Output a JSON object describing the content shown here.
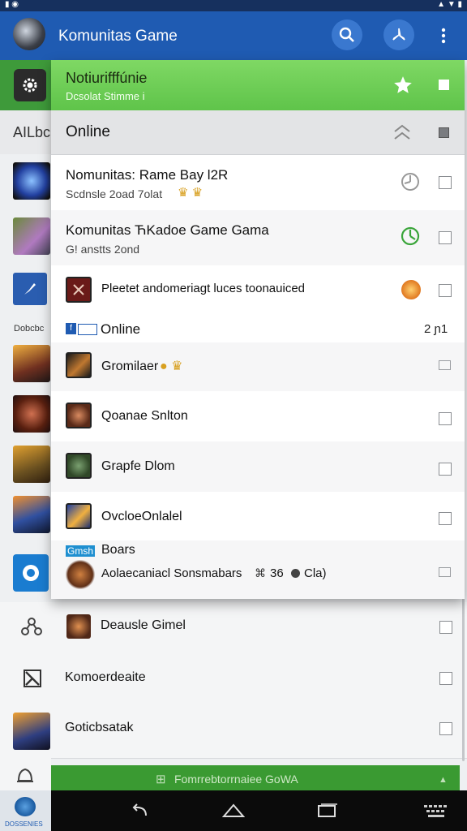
{
  "app_title": "Komunitas Game",
  "background_label": "AILbc",
  "side_caption": "Dobcbc",
  "bottom_left_caption": "DOSSENIES",
  "notification": {
    "title": "Notiurifffúnie",
    "subtitle": "Dcsolat Stimme i"
  },
  "online_header": "Online",
  "items": [
    {
      "title": "Nomunitas: Rame Bay l2R",
      "subtitle": "Scdnsle 2oad 7olat"
    },
    {
      "title": "Komunitas ЋKadoe Game Gama",
      "subtitle": "G! anstts 2ond"
    },
    {
      "title": "Pleetet andomeriagt luces toonauiced"
    }
  ],
  "online_section": {
    "label": "Online",
    "count": "2 ɲ1"
  },
  "players": [
    {
      "name": "Gromilaer"
    },
    {
      "name": "Qoanae Snlton"
    },
    {
      "name": "Grapfe Dlom"
    },
    {
      "name": "OvcloeOnlalel"
    }
  ],
  "boars": {
    "tag": "Gmsh",
    "label": "Boars",
    "text": "Aolaecaniacl Sonsmabars",
    "stats": "36",
    "tail": "Cla)"
  },
  "below_rows": [
    {
      "name": "Deausle Gimel"
    },
    {
      "name": "Komoerdeaite"
    },
    {
      "name": "Goticbsatak"
    }
  ],
  "bottom_bar": "Fomrrebtorrnaiee GoWA",
  "colors": {
    "appbar": "#1f5bb2",
    "notification_green": "#6fce55",
    "bottom_green": "#3a9a32"
  }
}
